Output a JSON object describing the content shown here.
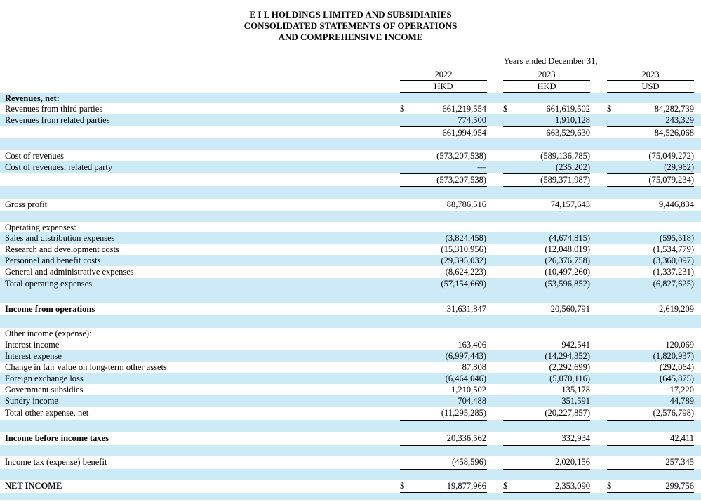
{
  "title": {
    "line1": "E I L HOLDINGS LIMITED AND SUBSIDIARIES",
    "line2": "CONSOLIDATED STATEMENTS OF OPERATIONS",
    "line3": "AND COMPREHENSIVE INCOME"
  },
  "columns": {
    "period": "Years ended December 31,",
    "years": [
      "2022",
      "2023",
      "2023"
    ],
    "currencies": [
      "HKD",
      "HKD",
      "USD"
    ],
    "dollar_sign": "$"
  },
  "rows": [
    {
      "label": "Revenues, net:",
      "bold": true,
      "values": [
        "",
        "",
        ""
      ]
    },
    {
      "label": "Revenues from third parties",
      "values": [
        "661,219,554",
        "661,619,502",
        "84,282,739"
      ]
    },
    {
      "label": "Revenues from related parties",
      "values": [
        "774,500",
        "1,910,128",
        "243,329"
      ]
    },
    {
      "label": "",
      "values": [
        "661,994,054",
        "663,529,630",
        "84,526,068"
      ]
    },
    {
      "label": "Cost of revenues",
      "values": [
        "(573,207,538)",
        "(589,136,785)",
        "(75,049,272)"
      ]
    },
    {
      "label": "Cost of revenues, related party",
      "values": [
        "—",
        "(235,202)",
        "(29,962)"
      ]
    },
    {
      "label": "",
      "values": [
        "(573,207,538)",
        "(589,371,987)",
        "(75,079,234)"
      ]
    },
    {
      "label": "Gross profit",
      "values": [
        "88,786,516",
        "74,157,643",
        "9,446,834"
      ]
    },
    {
      "label": "Operating expenses:",
      "values": [
        "",
        "",
        ""
      ]
    },
    {
      "label": "Sales and distribution expenses",
      "values": [
        "(3,824,458)",
        "(4,674,815)",
        "(595,518)"
      ]
    },
    {
      "label": "Research and development costs",
      "values": [
        "(15,310,956)",
        "(12,048,019)",
        "(1,534,779)"
      ]
    },
    {
      "label": "Personnel and benefit costs",
      "values": [
        "(29,395,032)",
        "(26,376,758)",
        "(3,360,097)"
      ]
    },
    {
      "label": "General and administrative expenses",
      "values": [
        "(8,624,223)",
        "(10,497,260)",
        "(1,337,231)"
      ]
    },
    {
      "label": "Total operating expenses",
      "values": [
        "(57,154,669)",
        "(53,596,852)",
        "(6,827,625)"
      ]
    },
    {
      "label": "Income from operations",
      "bold": true,
      "values": [
        "31,631,847",
        "20,560,791",
        "2,619,209"
      ]
    },
    {
      "label": "Other income (expense):",
      "values": [
        "",
        "",
        ""
      ]
    },
    {
      "label": "Interest income",
      "values": [
        "163,406",
        "942,541",
        "120,069"
      ]
    },
    {
      "label": "Interest expense",
      "values": [
        "(6,997,443)",
        "(14,294,352)",
        "(1,820,937)"
      ]
    },
    {
      "label": "Change in fair value on long-term other assets",
      "values": [
        "87,808",
        "(2,292,699)",
        "(292,064)"
      ]
    },
    {
      "label": "Foreign exchange loss",
      "values": [
        "(6,464,046)",
        "(5,070,116)",
        "(645,875)"
      ]
    },
    {
      "label": "Government subsidies",
      "values": [
        "1,210,502",
        "135,178",
        "17,220"
      ]
    },
    {
      "label": "Sundry income",
      "values": [
        "704,488",
        "351,591",
        "44,789"
      ]
    },
    {
      "label": "Total other expense, net",
      "values": [
        "(11,295,285)",
        "(20,227,857)",
        "(2,576,798)"
      ]
    },
    {
      "label": "Income before income taxes",
      "bold": true,
      "values": [
        "20,336,562",
        "332,934",
        "42,411"
      ]
    },
    {
      "label": "Income tax (expense) benefit",
      "values": [
        "(458,596)",
        "2,020,156",
        "257,345"
      ]
    },
    {
      "label": "NET INCOME",
      "bold": true,
      "values": [
        "19,877,966",
        "2,353,090",
        "299,756"
      ]
    }
  ]
}
